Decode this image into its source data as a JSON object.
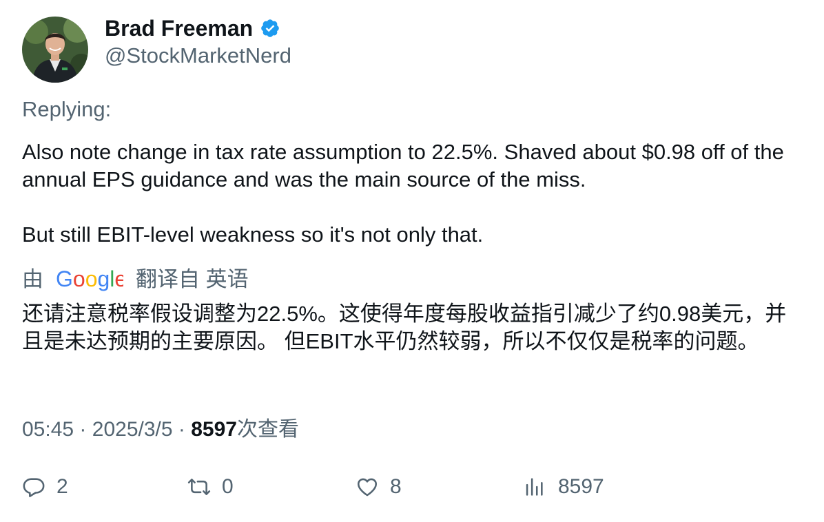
{
  "author": {
    "name": "Brad Freeman",
    "handle": "@StockMarketNerd",
    "verified": true,
    "verified_color": "#1d9bf0"
  },
  "replying_label": "Replying:",
  "tweet": {
    "paragraphs": [
      "Also note change in tax rate assumption to 22.5%. Shaved about $0.98 off of the annual EPS guidance and was the main source of the miss.",
      "But still EBIT-level weakness so it's not only that."
    ]
  },
  "translation": {
    "by_label": "由",
    "provider": "Google",
    "from_label": "翻译自 英语",
    "text": "还请注意税率假设调整为22.5%。这使得年度每股收益指引减少了约0.98美元，并且是未达预期的主要原因。 但EBIT水平仍然较弱，所以不仅仅是税率的问题。"
  },
  "meta": {
    "time": "05:45",
    "separator": "·",
    "date": "2025/3/5",
    "views_count": "8597",
    "views_label": "次查看"
  },
  "actions": {
    "replies": "2",
    "reposts": "0",
    "likes": "8",
    "views": "8597"
  },
  "colors": {
    "secondary_text": "#536471",
    "primary_text": "#0f1419",
    "google_blue": "#4285F4",
    "google_red": "#EA4335",
    "google_yellow": "#FBBC05",
    "google_green": "#34A853"
  }
}
